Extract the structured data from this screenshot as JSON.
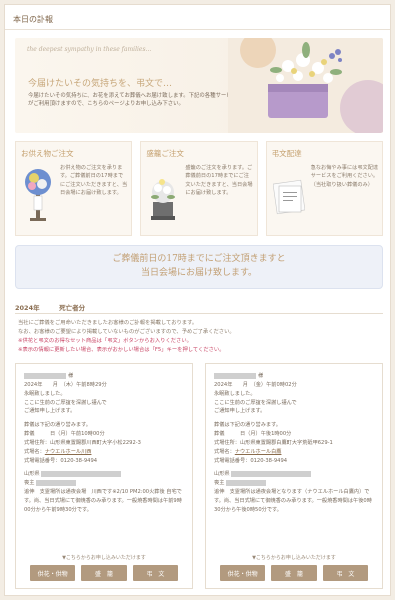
{
  "header": {
    "title": "本日の訃報"
  },
  "hero": {
    "script_text": "the deepest sympathy in these families...",
    "headline": "今届けたいその気持ちを、弔文で…",
    "description": "今届けたいその気持ちに、お花を添えてお葬儀へお届け致します。下記の各種サービスがご利用頂けますので、こちらのページよりお申し込み下さい。"
  },
  "cards": [
    {
      "title": "お供え物ご注文",
      "text": "お供え物のご注文を承ります。ご葬儀前日の17時までにご注文いただきますと、当日会場にお届け致します。"
    },
    {
      "title": "盛籠ご注文",
      "text": "盛籠のご注文を承ります。ご葬儀前日の17時までにご注文いただきますと、当日会場にお届け致します。"
    },
    {
      "title": "弔文配達",
      "text": "急なお悔やみ事には弔文配達サービスをご利用ください。（当社取り扱い葬儀のみ）"
    }
  ],
  "deadline": {
    "line1": "ご葬儀前日の17時までにご注文頂きますと",
    "line2": "当日会場にお届け致します。"
  },
  "section": {
    "title": "2024年　　　死亡者分"
  },
  "notes": {
    "line1": "当社にご葬儀をご用命いただきましたお客様のご訃報を掲載しております。",
    "line2": "なお、お客様のご要望により掲載していないものがございますので、予めご了承ください。",
    "red1": "※供花と弔文のお得なセット商品は「弔文」ボタンからお入りください。",
    "red2": "※表示の情報に更新したい場合、表示がおかしい場合は「F5」キーを押してください。"
  },
  "notices": [
    {
      "sama": "様",
      "died": "2024年　　月　（木）午前8時29分",
      "passed": "永眠致しました。",
      "announce1": "ここに生前のご厚誼を深謝し謹んで",
      "announce2": "ご通知申し上げます。",
      "funeral_intro": "葬儀は下記の通り営みます。",
      "ceremony": "葬儀　　　日（月）午前10時00分",
      "venue_addr": "式場住所：山形県東置賜郡川西町大字小松2292-3",
      "venue_label": "式場名：",
      "venue_name": "ナウエルホール川西",
      "venue_tel": "式場電話番号：0120-38-9494",
      "chief_pref": "山形県",
      "chief_label": "喪主",
      "remark_label": "追伸　",
      "remark": "支霊場所は通夜会場　川西です※2/10 PM2:00火葬後 自宅です。尚、当日式場にて御焼香のみ承ります。一般焼香時間は午前9時00分から午前9時30分です。",
      "apply": "▼こちらからお申し込みいただけます",
      "buttons": [
        "供花・供物",
        "盛　籠",
        "弔　文"
      ]
    },
    {
      "sama": "様",
      "died": "2024年　　月　（金）午前0時02分",
      "passed": "永眠致しました。",
      "announce1": "ここに生前のご厚誼を深謝し謹んで",
      "announce2": "ご通知申し上げます。",
      "funeral_intro": "葬儀は下記の通り営みます。",
      "ceremony": "葬儀　　　日（月）午後1時00分",
      "venue_addr": "式場住所：山形県東置賜郡白鷹町大字荒砥甲629-1",
      "venue_label": "式場名：",
      "venue_name": "ナウエルホール白鷹",
      "venue_tel": "式場電話番号：0120-38-9494",
      "chief_pref": "山形県",
      "chief_label": "喪主",
      "remark_label": "追伸　",
      "remark": "支霊場所は通夜会場となります（ナウエルホール白鷹内）です。尚、当日式場にて御焼香のみ承ります。一般焼香時間は午後0時30分から午後0時50分です。",
      "apply": "▼こちらからお申し込みいただけます",
      "buttons": [
        "供花・供物",
        "盛　籠",
        "弔　文"
      ]
    }
  ]
}
